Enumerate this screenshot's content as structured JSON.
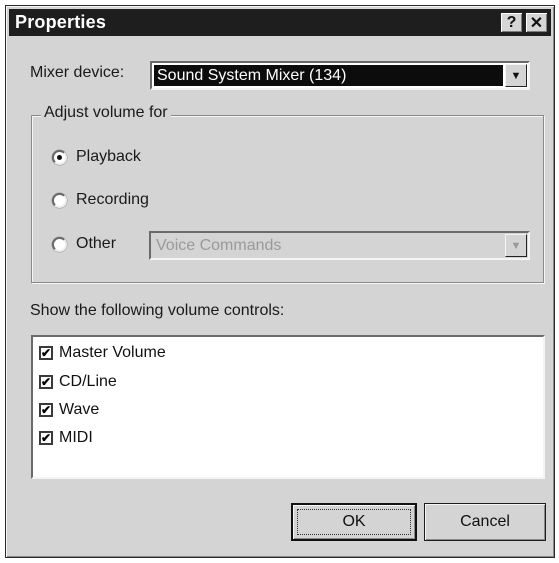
{
  "window": {
    "title": "Properties",
    "help_button": "?",
    "close_button": "✕"
  },
  "mixer": {
    "label": "Mixer device:",
    "value": "Sound System Mixer (134)"
  },
  "adjust": {
    "legend": "Adjust volume for",
    "options": [
      {
        "label": "Playback",
        "selected": true
      },
      {
        "label": "Recording",
        "selected": false
      },
      {
        "label": "Other",
        "selected": false
      }
    ],
    "other_value": "Voice Commands"
  },
  "controls": {
    "label": "Show the following volume controls:",
    "items": [
      {
        "label": "Master Volume",
        "checked": true
      },
      {
        "label": "CD/Line",
        "checked": true
      },
      {
        "label": "Wave",
        "checked": true
      },
      {
        "label": "MIDI",
        "checked": true
      }
    ]
  },
  "buttons": {
    "ok": "OK",
    "cancel": "Cancel"
  }
}
